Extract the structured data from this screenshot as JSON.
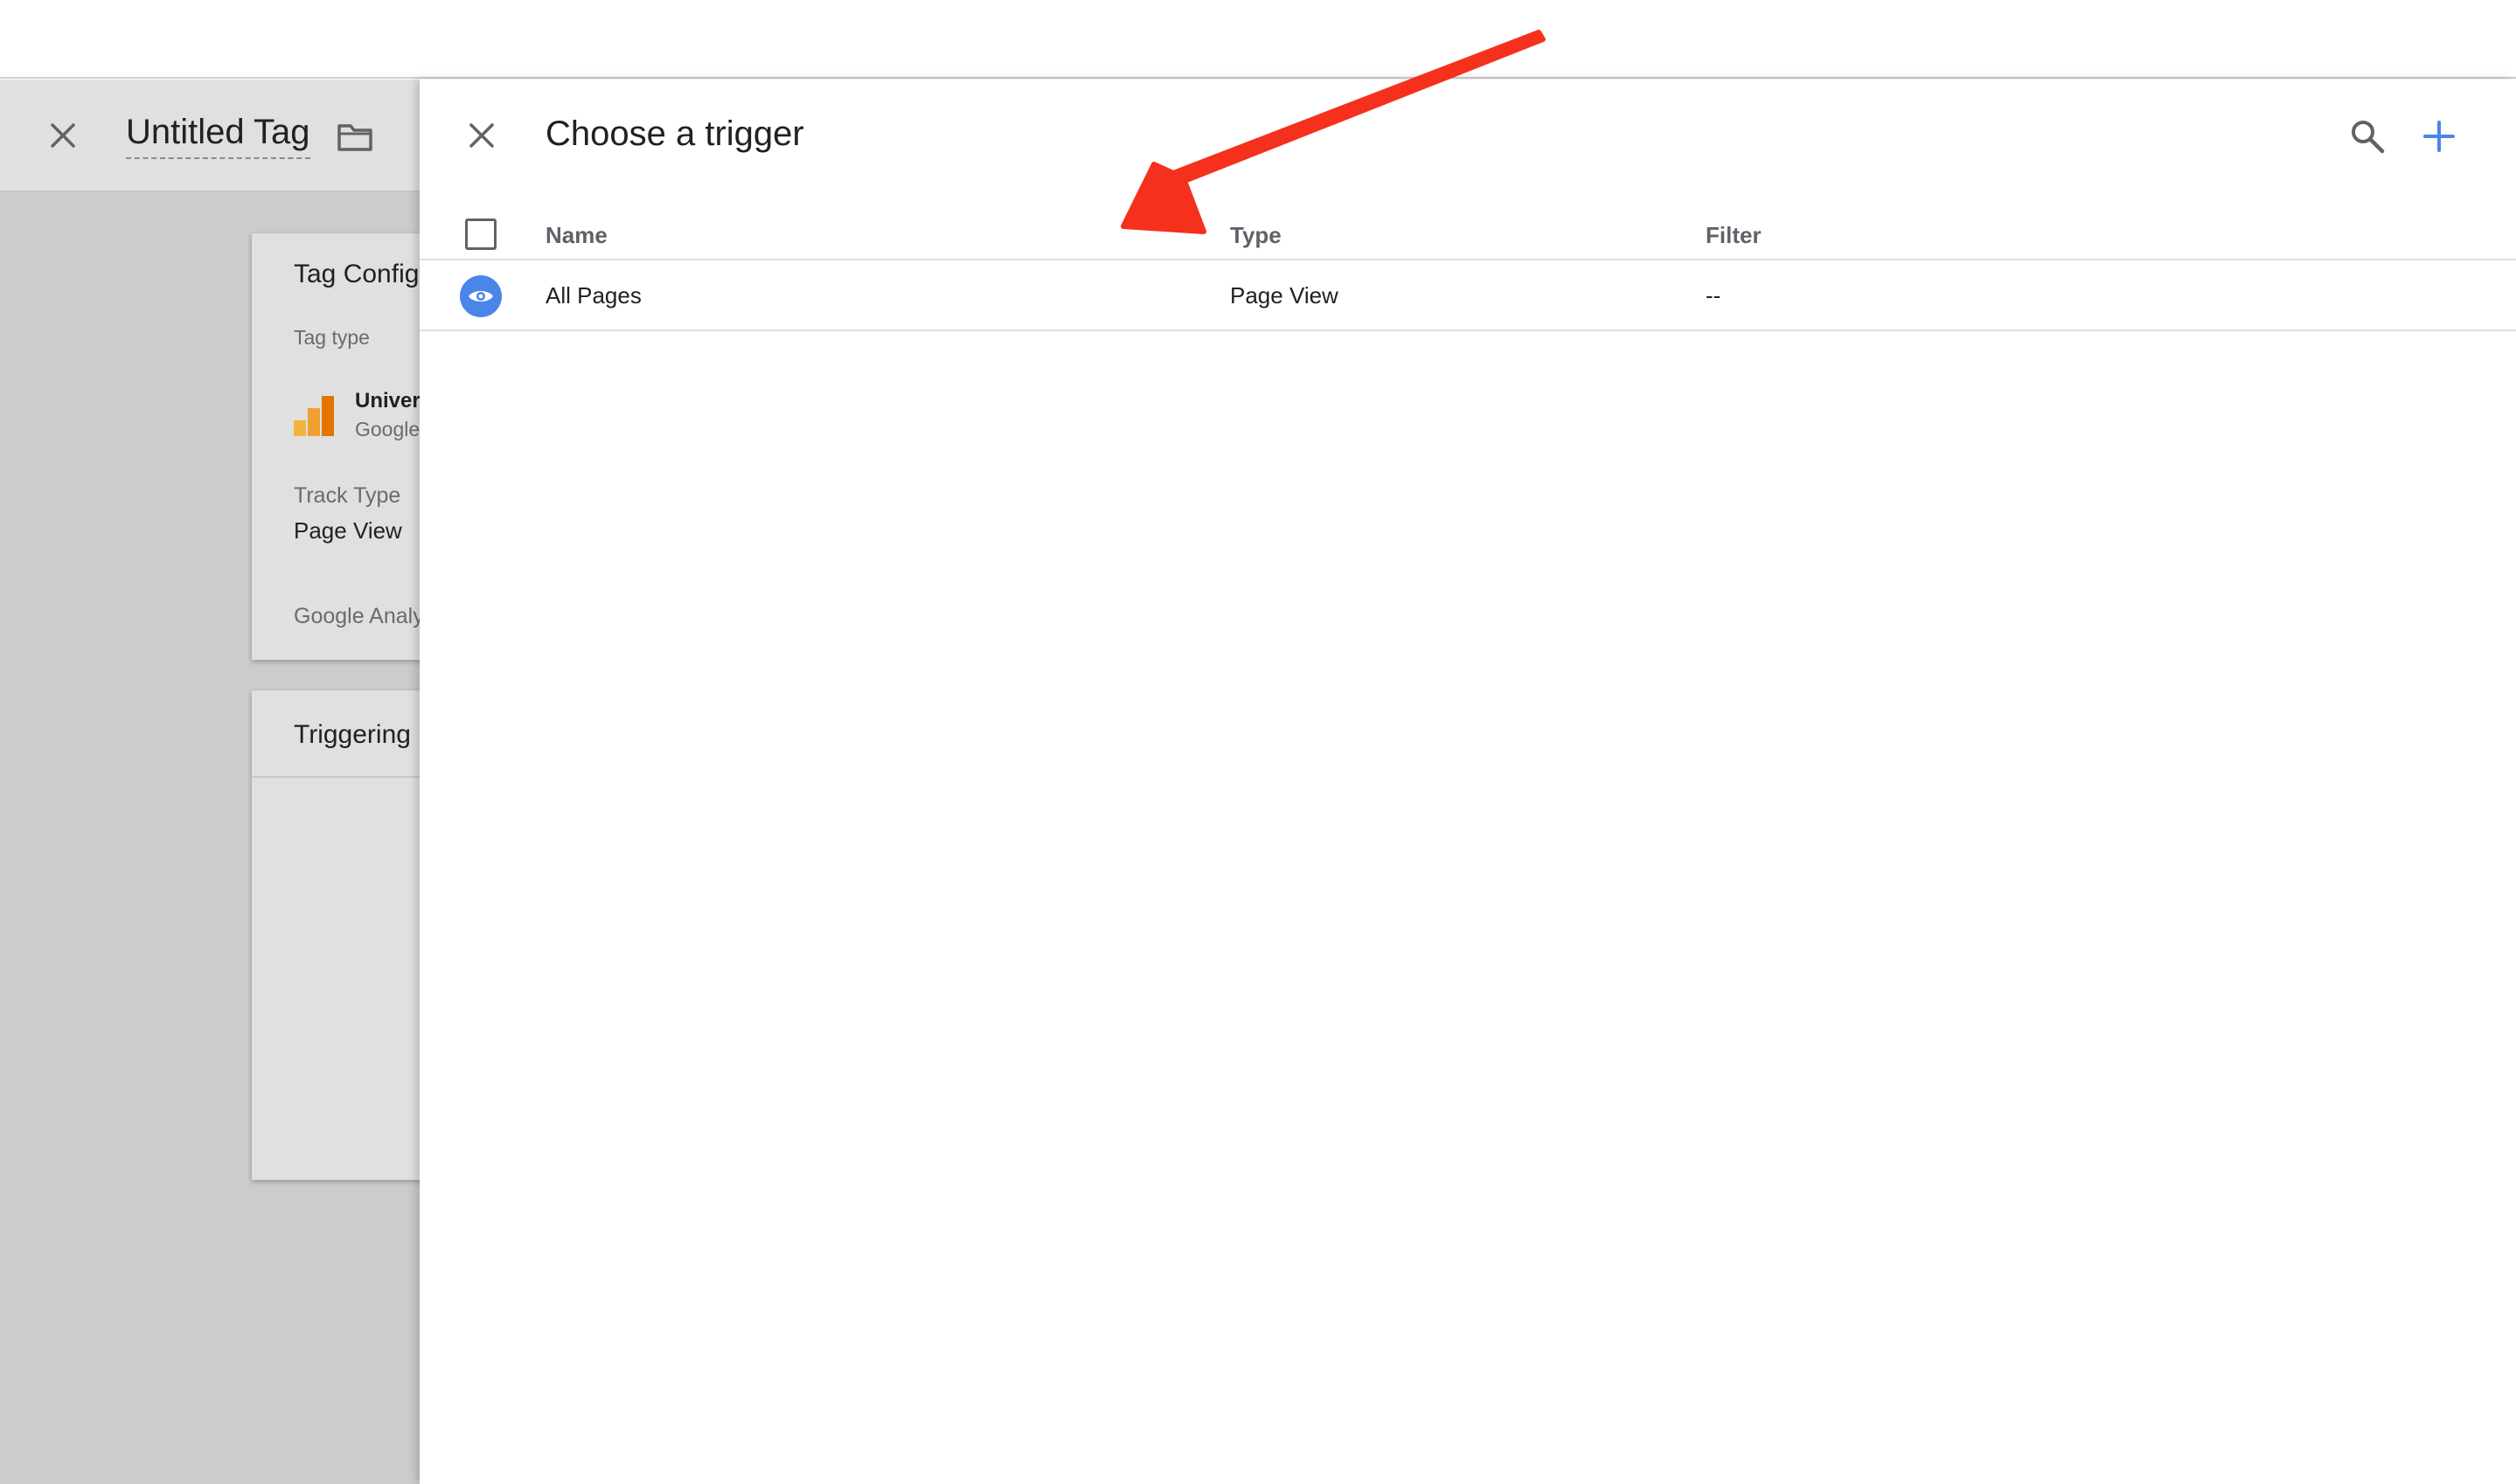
{
  "colors": {
    "accent": "#4a86e8",
    "annotation_arrow": "#f5301c",
    "overlay_background": "#cccccc"
  },
  "tag_editor": {
    "title": "Untitled Tag",
    "close_icon": "close-icon",
    "folder_icon": "folder-icon",
    "config_card": {
      "title": "Tag Config",
      "tag_type_label": "Tag type",
      "tag_type_name": "Univer",
      "tag_type_sub": "Google",
      "track_type_label": "Track Type",
      "track_type_value": "Page View",
      "settings_label": "Google Analy"
    },
    "triggering_card": {
      "title": "Triggering"
    }
  },
  "trigger_picker": {
    "title": "Choose a trigger",
    "close_icon": "close-icon",
    "search_icon": "search-icon",
    "add_icon": "plus-icon",
    "columns": [
      "Name",
      "Type",
      "Filter"
    ],
    "rows": [
      {
        "icon": "eye-icon",
        "name": "All Pages",
        "type": "Page View",
        "filter": "--"
      }
    ]
  }
}
